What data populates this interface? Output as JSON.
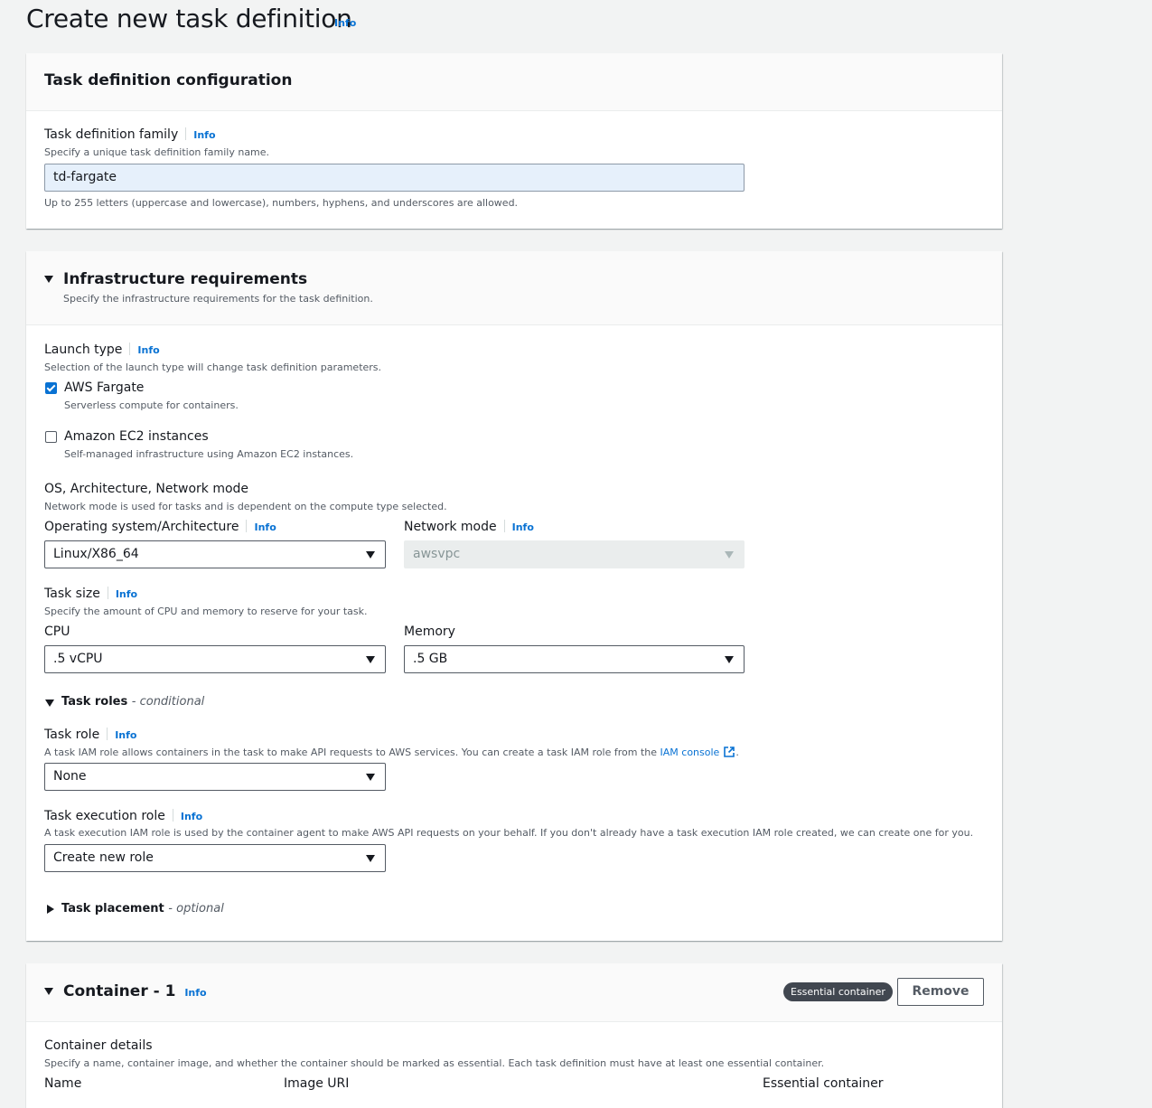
{
  "page": {
    "title": "Create new task definition",
    "info": "Info"
  },
  "task_config": {
    "title": "Task definition configuration",
    "family_label": "Task definition family",
    "family_info": "Info",
    "family_desc": "Specify a unique task definition family name.",
    "family_value": "td-fargate",
    "family_constraint": "Up to 255 letters (uppercase and lowercase), numbers, hyphens, and underscores are allowed."
  },
  "infra": {
    "title": "Infrastructure requirements",
    "subtitle": "Specify the infrastructure requirements for the task definition.",
    "launch_type": {
      "label": "Launch type",
      "info": "Info",
      "desc": "Selection of the launch type will change task definition parameters.",
      "options": [
        {
          "label": "AWS Fargate",
          "desc": "Serverless compute for containers.",
          "checked": true
        },
        {
          "label": "Amazon EC2 instances",
          "desc": "Self-managed infrastructure using Amazon EC2 instances.",
          "checked": false
        }
      ]
    },
    "os_network": {
      "label": "OS, Architecture, Network mode",
      "desc": "Network mode is used for tasks and is dependent on the compute type selected.",
      "os_label": "Operating system/Architecture",
      "os_info": "Info",
      "os_value": "Linux/X86_64",
      "network_label": "Network mode",
      "network_info": "Info",
      "network_value": "awsvpc"
    },
    "task_size": {
      "label": "Task size",
      "info": "Info",
      "desc": "Specify the amount of CPU and memory to reserve for your task.",
      "cpu_label": "CPU",
      "cpu_value": ".5 vCPU",
      "memory_label": "Memory",
      "memory_value": ".5 GB"
    },
    "task_roles": {
      "heading": "Task roles",
      "qualifier": "- conditional",
      "task_role_label": "Task role",
      "task_role_info": "Info",
      "task_role_desc": "A task IAM role allows containers in the task to make API requests to AWS services. You can create a task IAM role from the ",
      "iam_console_link": "IAM console",
      "task_role_desc_end": ".",
      "task_role_value": "None",
      "exec_role_label": "Task execution role",
      "exec_role_info": "Info",
      "exec_role_desc": "A task execution IAM role is used by the container agent to make AWS API requests on your behalf. If you don't already have a task execution IAM role created, we can create one for you.",
      "exec_role_value": "Create new role"
    },
    "task_placement": {
      "heading": "Task placement",
      "qualifier": "- optional"
    }
  },
  "container": {
    "title": "Container - 1",
    "info": "Info",
    "badge": "Essential container",
    "remove_label": "Remove",
    "details_label": "Container details",
    "details_desc": "Specify a name, container image, and whether the container should be marked as essential. Each task definition must have at least one essential container.",
    "col_name": "Name",
    "col_image": "Image URI",
    "col_essential": "Essential container"
  },
  "colors": {
    "link": "#0972d3",
    "page_bg": "#f2f3f3",
    "input_focus_bg": "#e6f0fb",
    "badge_bg": "#414750"
  }
}
